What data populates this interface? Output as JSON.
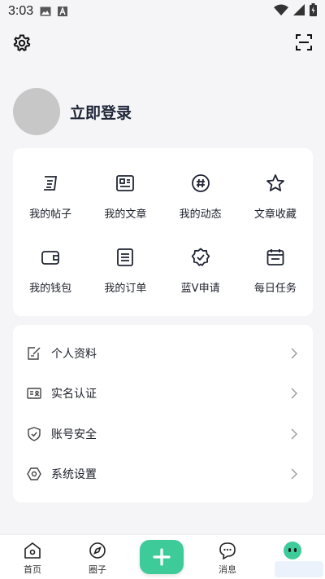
{
  "status_bar": {
    "time": "3:03"
  },
  "profile": {
    "login_label": "立即登录"
  },
  "grid": {
    "items": [
      {
        "label": "我的帖子",
        "icon": "post-icon"
      },
      {
        "label": "我的文章",
        "icon": "article-icon"
      },
      {
        "label": "我的动态",
        "icon": "hashtag-icon"
      },
      {
        "label": "文章收藏",
        "icon": "star-icon"
      },
      {
        "label": "我的钱包",
        "icon": "wallet-icon"
      },
      {
        "label": "我的订单",
        "icon": "order-icon"
      },
      {
        "label": "蓝V申请",
        "icon": "verified-badge-icon"
      },
      {
        "label": "每日任务",
        "icon": "calendar-icon"
      }
    ]
  },
  "menu": {
    "items": [
      {
        "label": "个人资料",
        "icon": "edit-profile-icon"
      },
      {
        "label": "实名认证",
        "icon": "id-card-icon"
      },
      {
        "label": "账号安全",
        "icon": "shield-icon"
      },
      {
        "label": "系统设置",
        "icon": "settings-hexagon-icon"
      }
    ]
  },
  "bottom_nav": {
    "items": [
      {
        "label": "首页",
        "icon": "home-icon"
      },
      {
        "label": "圈子",
        "icon": "compass-icon"
      },
      {
        "label": "消息",
        "icon": "message-icon"
      },
      {
        "label": "",
        "icon": "me-icon"
      }
    ],
    "accent": "#3ecb9a"
  }
}
